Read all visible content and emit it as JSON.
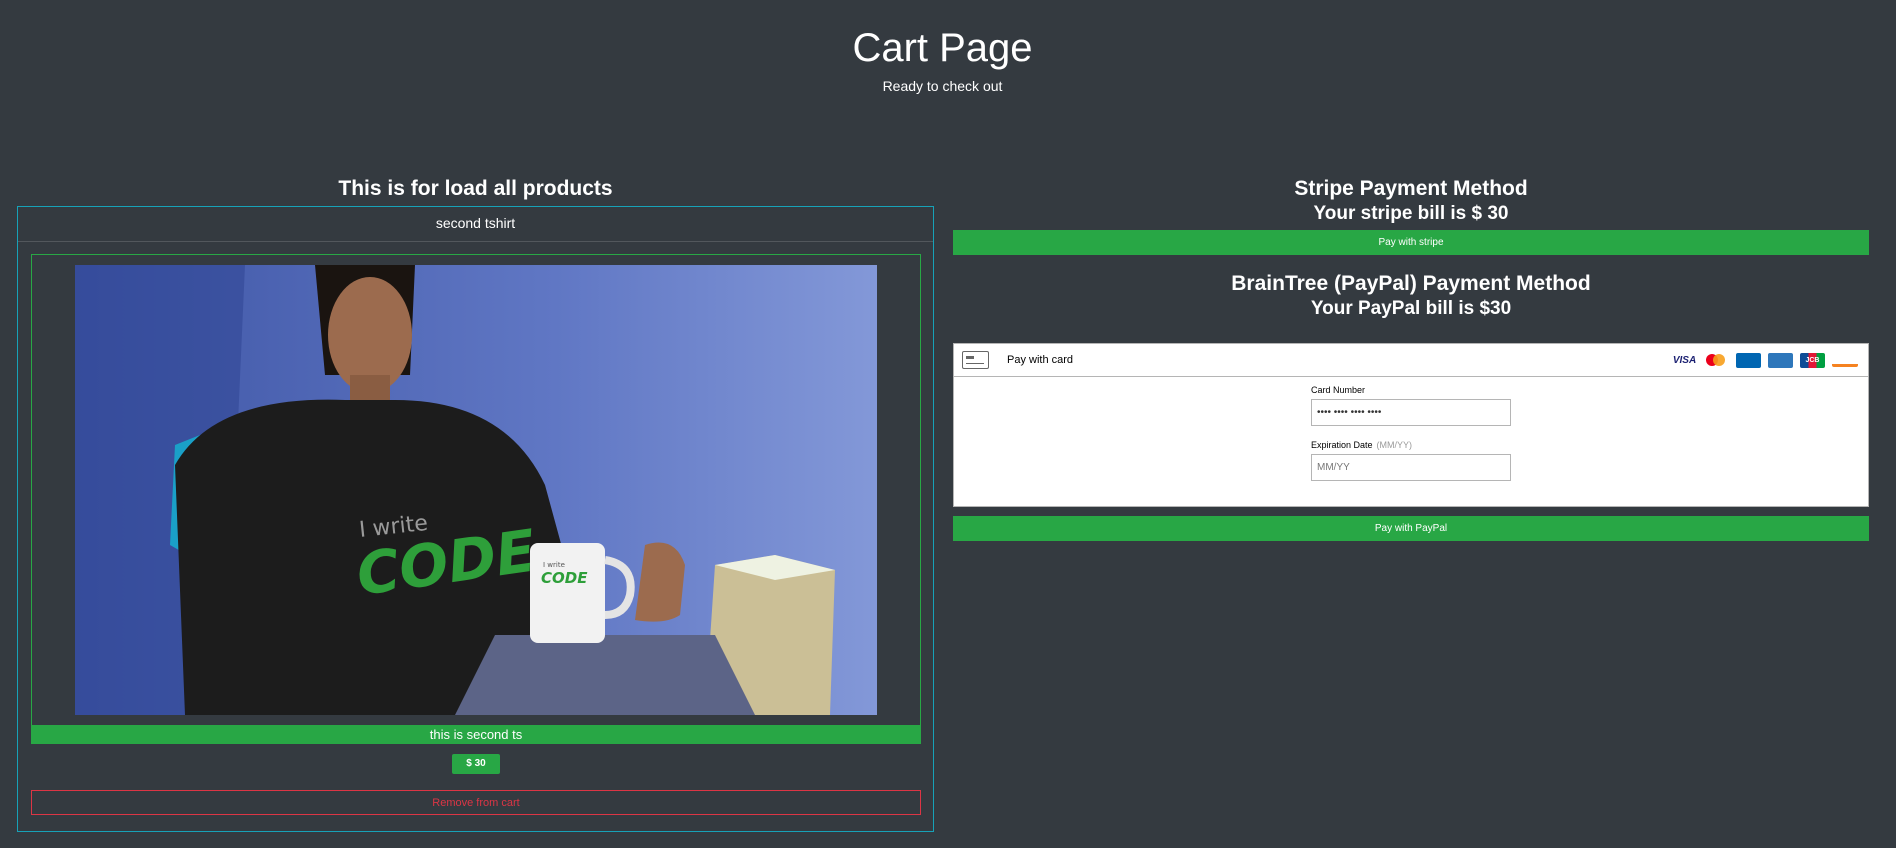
{
  "header": {
    "title": "Cart Page",
    "subtitle": "Ready to check out"
  },
  "products": {
    "section_title": "This is for load all products",
    "item": {
      "name": "second tshirt",
      "description": "this is second ts",
      "price": "$ 30",
      "remove_label": "Remove from cart",
      "shirt_text_line1": "I write",
      "shirt_text_line2": "CODE",
      "mug_text_line1": "I write",
      "mug_text_line2": "CODE"
    }
  },
  "stripe": {
    "title": "Stripe Payment Method",
    "bill": "Your stripe bill is $ 30",
    "button_label": "Pay with stripe"
  },
  "braintree": {
    "title": "BrainTree (PayPal) Payment Method",
    "bill": "Your PayPal bill is $30",
    "dropin": {
      "header_label": "Pay with card",
      "brands": [
        "VISA",
        "",
        "Maestro",
        "AMEX",
        "JCB",
        "DISCOVER"
      ],
      "card_number_label": "Card Number",
      "card_number_value": "•••• •••• •••• ••••",
      "expiry_label": "Expiration Date",
      "expiry_hint": "(MM/YY)",
      "expiry_placeholder": "MM/YY"
    },
    "button_label": "Pay with PayPal"
  },
  "colors": {
    "background": "#343a40",
    "success": "#28a745",
    "info": "#17a2b8",
    "danger": "#dc3545"
  }
}
